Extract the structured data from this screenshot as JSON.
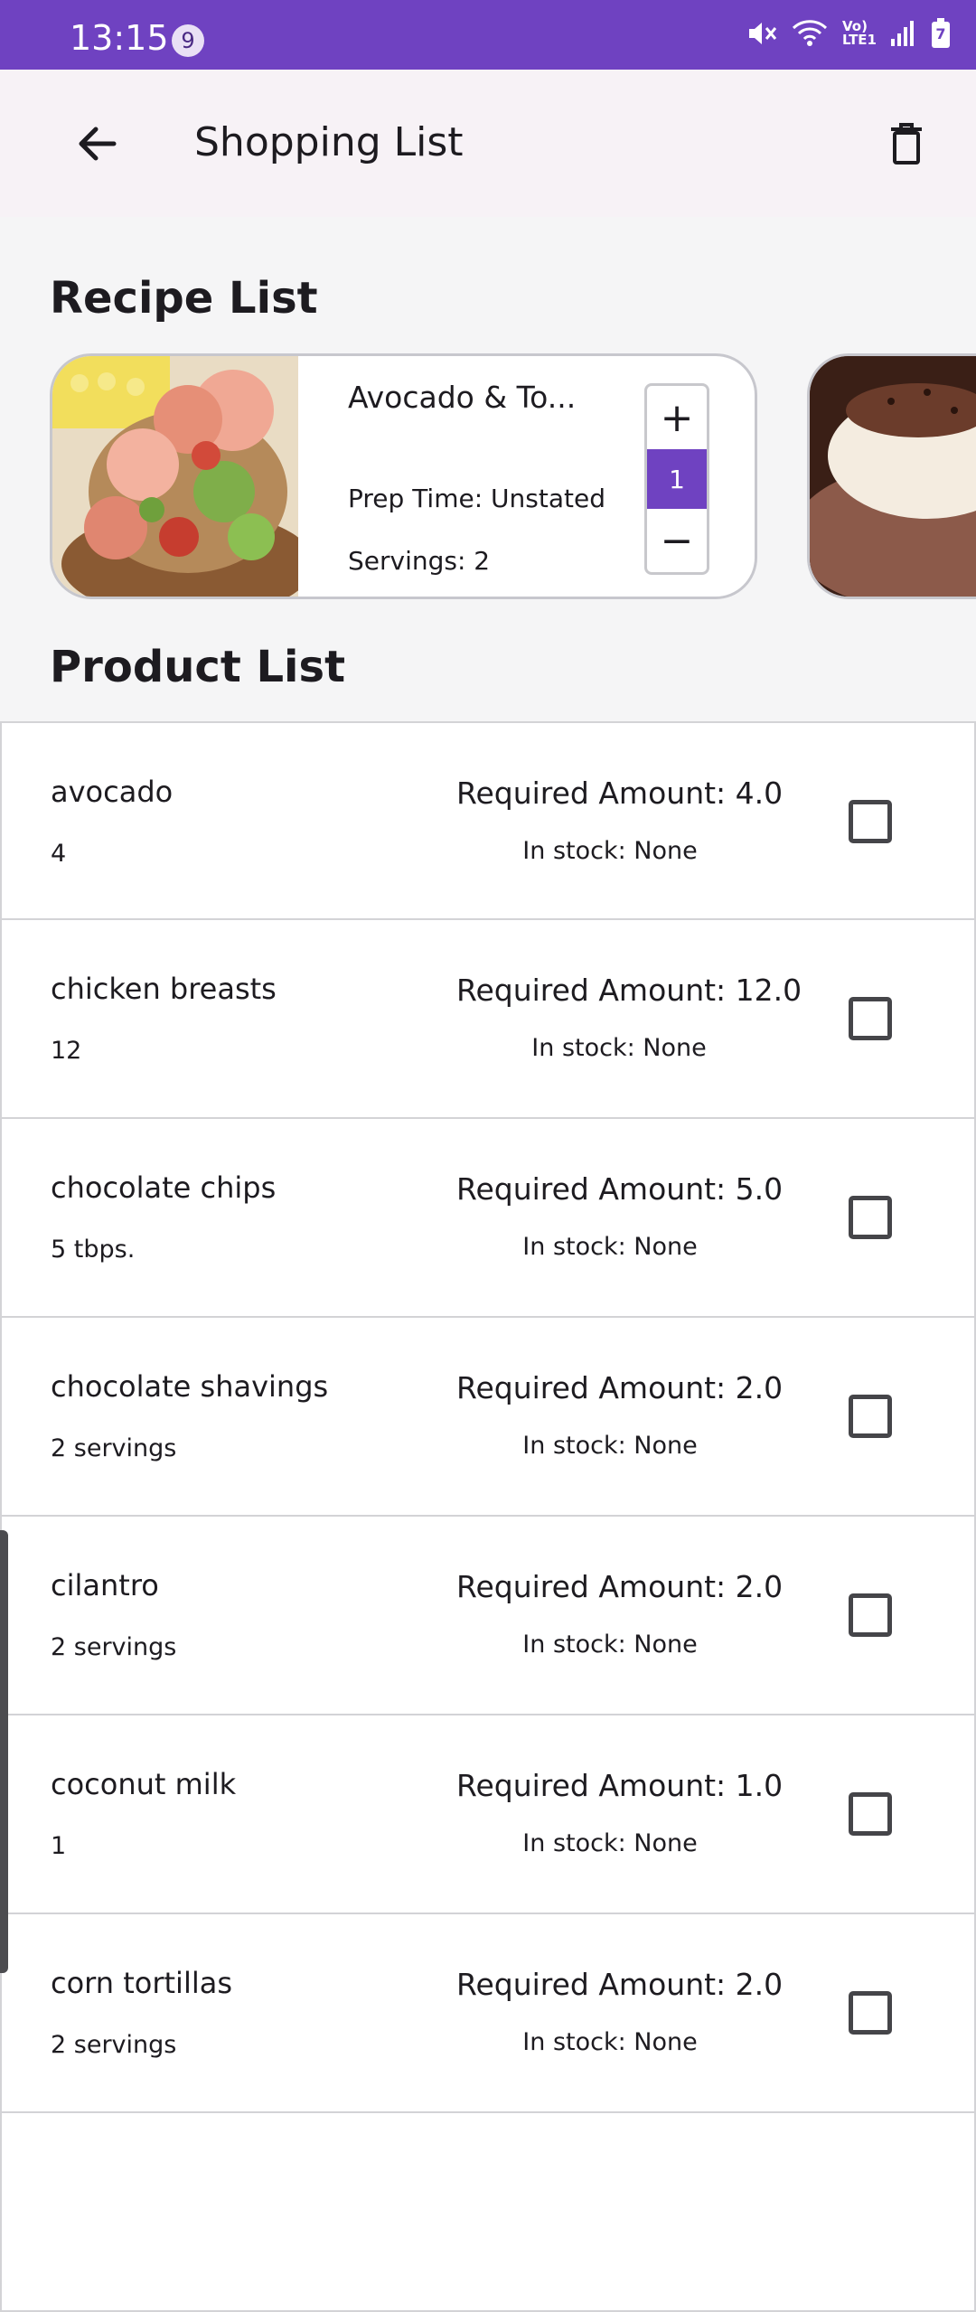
{
  "status_bar": {
    "time": "13:15",
    "notification_count": "9",
    "network_label": "Vo) LTE1",
    "battery_level": "7"
  },
  "app_bar": {
    "title": "Shopping List"
  },
  "recipe_section": {
    "title": "Recipe List",
    "cards": [
      {
        "name": "Avocado & To...",
        "prep_time": "Prep Time: Unstated",
        "servings": "Servings: 2",
        "stepper_plus": "+",
        "stepper_value": "1",
        "stepper_minus": "−"
      }
    ]
  },
  "product_section": {
    "title": "Product List",
    "items": [
      {
        "name": "avocado",
        "quantity": "4",
        "required": "Required Amount: 4.0",
        "stock": "In stock: None",
        "checked": false
      },
      {
        "name": "chicken breasts",
        "quantity": "12",
        "required": "Required Amount: 12.0",
        "stock": "In stock: None",
        "checked": false
      },
      {
        "name": "chocolate chips",
        "quantity": "5 tbps.",
        "required": "Required Amount: 5.0",
        "stock": "In stock: None",
        "checked": false
      },
      {
        "name": "chocolate shavings",
        "quantity": "2 servings",
        "required": "Required Amount: 2.0",
        "stock": "In stock: None",
        "checked": false
      },
      {
        "name": "cilantro",
        "quantity": "2 servings",
        "required": "Required Amount: 2.0",
        "stock": "In stock: None",
        "checked": false
      },
      {
        "name": "coconut milk",
        "quantity": "1",
        "required": "Required Amount: 1.0",
        "stock": "In stock: None",
        "checked": false
      },
      {
        "name": "corn tortillas",
        "quantity": "2 servings",
        "required": "Required Amount: 2.0",
        "stock": "In stock: None",
        "checked": false
      },
      {
        "name": "",
        "quantity": "",
        "required": "",
        "stock": "",
        "checked": false
      }
    ]
  },
  "colors": {
    "accent": "#6f42c1",
    "app_bar_bg": "#f7f2f6",
    "page_bg": "#f5f5f6"
  },
  "icons": {
    "back": "arrow-left-icon",
    "delete": "trash-icon",
    "checkbox": "checkbox-unchecked-icon"
  }
}
